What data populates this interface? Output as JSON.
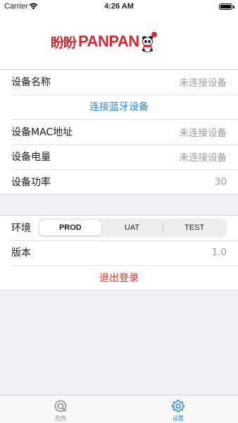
{
  "status_bar": {
    "carrier": "Carrier",
    "time": "4:26 AM"
  },
  "header": {
    "logo_text_cn": "盼盼",
    "logo_text_en": "PANPAN",
    "brand_color": "#d7282f"
  },
  "device": {
    "name_label": "设备名称",
    "name_value": "未连接设备",
    "connect_button": "连接蓝牙设备",
    "mac_label": "设备MAC地址",
    "mac_value": "未连接设备",
    "battery_label": "设备电量",
    "battery_value": "未连接设备",
    "power_label": "设备功率",
    "power_value": "30"
  },
  "settings": {
    "env_label": "环境",
    "env_options": [
      "PROD",
      "UAT",
      "TEST"
    ],
    "env_selected": "PROD",
    "version_label": "版本",
    "version_value": "1.0",
    "logout_button": "退出登录"
  },
  "tab_bar": {
    "tabs": [
      {
        "label": "防伪",
        "icon": "scan-icon",
        "active": false
      },
      {
        "label": "设置",
        "icon": "gear-icon",
        "active": true
      }
    ],
    "active_color": "#1e88e5",
    "inactive_color": "#8e8e93"
  }
}
